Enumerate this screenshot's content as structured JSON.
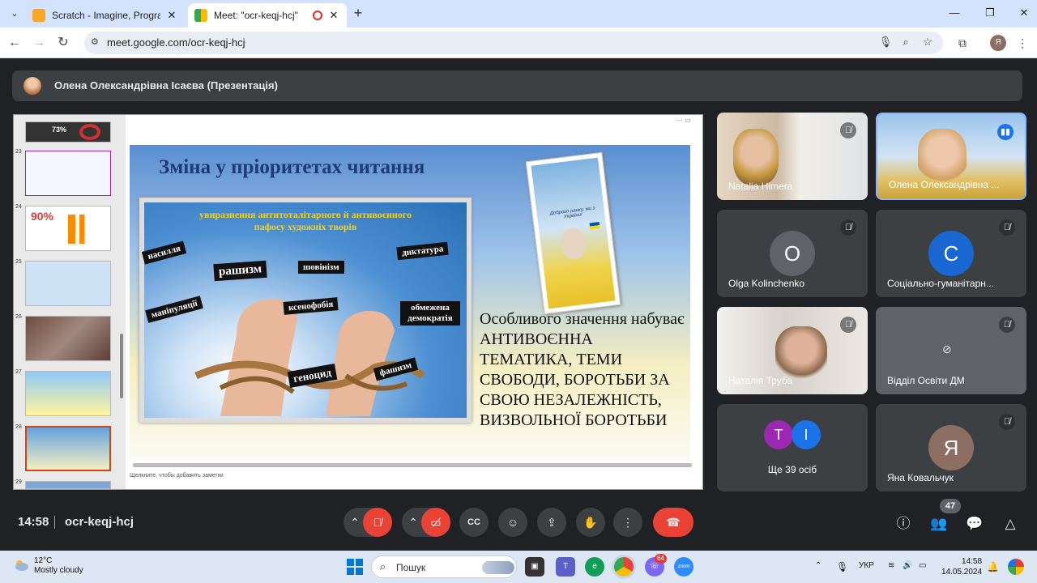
{
  "browser": {
    "tabs": [
      {
        "title": "Scratch - Imagine, Program, Sh",
        "favicon_color": "#f9a825"
      },
      {
        "title": "Meet: \"ocr-keqj-hcj\"",
        "favicon_color": "#34a853"
      }
    ],
    "url": "meet.google.com/ocr-keqj-hcj",
    "profile_initial": "Я"
  },
  "presentation": {
    "presenter": "Олена Олександрівна Ісаєва (Презентація)"
  },
  "slide": {
    "title": "Зміна у пріоритетах читання",
    "caption": "увиразнення антитоталітарного й антивоєнного пафосу художніх творів",
    "labels": {
      "l1": "насилля",
      "l2": "рашизм",
      "l3": "шовінізм",
      "l4": "диктатура",
      "l5": "маніпуляції",
      "l6": "ксенофобія",
      "l7": "обмежена демократія",
      "l8": "геноцид",
      "l9": "фашизм"
    },
    "poster_text": "Доброго ранку, ми з України!",
    "body": "Особливого значення набуває АНТИВОЄННА ТЕМАТИКА, ТЕМИ СВОБОДИ, БОРОТЬБИ ЗА СВОЮ НЕЗАЛЕЖНІСТЬ, ВИЗВОЛЬНОЇ БОРОТЬБИ",
    "notes_placeholder": "Щелкните, чтобы добавить заметки",
    "thumb_numbers": [
      "23",
      "24",
      "25",
      "26",
      "27",
      "28",
      "29"
    ],
    "thumb_top_value": "73%",
    "thumb_24_value": "90%"
  },
  "participants": [
    {
      "name": "Natalia Himera",
      "avatar": ""
    },
    {
      "name": "Олена Олександрівна ...",
      "avatar": ""
    },
    {
      "name": "Olga Kolinchenko",
      "avatar": "O",
      "color": "#5f6368"
    },
    {
      "name": "Соціально-гуманітарн...",
      "avatar": "C",
      "color": "#1967d2"
    },
    {
      "name": "Наталія Труба",
      "avatar": ""
    },
    {
      "name": "Відділ Освіти ДМ",
      "avatar": ""
    },
    {
      "name": "Ще 39 осіб",
      "avatars": [
        "T",
        "I"
      ]
    },
    {
      "name": "Яна Ковальчук",
      "avatar": "Я",
      "color": "#8d6e63"
    }
  ],
  "controls": {
    "time": "14:58",
    "meeting_code": "ocr-keqj-hcj",
    "people_count": "47"
  },
  "taskbar": {
    "temperature": "12°C",
    "weather": "Mostly cloudy",
    "search_placeholder": "Пошук",
    "language": "УКР",
    "time": "14:58",
    "date": "14.05.2024",
    "notification_badge": "64"
  }
}
